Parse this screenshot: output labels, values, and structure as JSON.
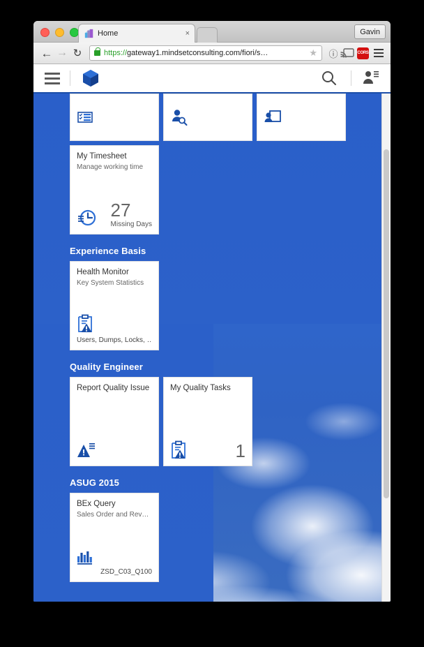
{
  "browser": {
    "tab": {
      "title": "Home",
      "close_label": "×",
      "favicon": "sap-logo-favicon"
    },
    "profile_button": "Gavin",
    "nav": {
      "back": "←",
      "forward": "→",
      "reload": "↻"
    },
    "address_bar": {
      "scheme": "https://",
      "rest": "gateway1.mindsetconsulting.com/fiori/s…",
      "full": "https://gateway1.mindsetconsulting.com/fiori/s…",
      "lock_icon": "lock-icon",
      "bookmark_icon": "star-icon"
    },
    "toolbar_icons": [
      "info-circle-icon",
      "cast-icon",
      "cors-extension-icon",
      "chrome-menu-icon"
    ],
    "extension_badge": "CORS",
    "new_tab_label": "+"
  },
  "fiori_header": {
    "menu_icon": "hamburger-menu-icon",
    "logo": "sap-cube-logo",
    "search_icon": "search-icon",
    "user_icon": "user-actions-icon"
  },
  "groups": [
    {
      "title": "",
      "partial": true,
      "tiles": [
        {
          "title": "",
          "icon": "form-table-icon"
        },
        {
          "title": "",
          "icon": "person-search-icon"
        },
        {
          "title": "",
          "icon": "person-card-icon"
        }
      ]
    },
    {
      "title": "",
      "tiles": [
        {
          "title": "My Timesheet",
          "subtitle": "Manage working time",
          "icon": "time-entry-clock-icon",
          "number": "27",
          "unit": "Missing Days"
        }
      ]
    },
    {
      "title": "Experience Basis",
      "tiles": [
        {
          "title": "Health Monitor",
          "subtitle": "Key System Statistics",
          "icon": "clipboard-warning-icon",
          "footer": "Users, Dumps, Locks, …"
        }
      ]
    },
    {
      "title": "Quality Engineer",
      "tiles": [
        {
          "title": "Report Quality Issue",
          "subtitle": "",
          "icon": "warning-notes-icon"
        },
        {
          "title": "My Quality Tasks",
          "subtitle": "",
          "icon": "clipboard-warning-icon",
          "number": "1"
        }
      ]
    },
    {
      "title": "ASUG 2015",
      "tiles": [
        {
          "title": "BEx Query",
          "subtitle": "Sales Order and Rev…",
          "icon": "bar-chart-icon",
          "footer": "ZSD_C03_Q100"
        }
      ]
    }
  ],
  "colors": {
    "fiori_blue": "#2a5fc9",
    "tile_accent": "#1a4fa8",
    "header_border": "#1b4ea8",
    "tile_bg": "#ffffff",
    "cors_red": "#d40f0f"
  }
}
